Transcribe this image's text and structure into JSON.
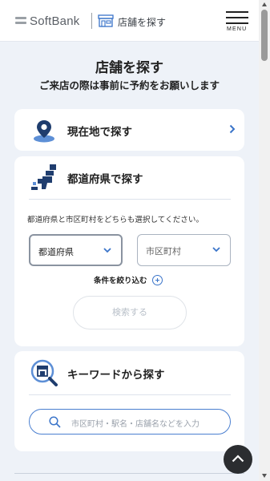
{
  "header": {
    "logo_text": "SoftBank",
    "title": "店舗を探す",
    "menu_label": "MENU"
  },
  "page": {
    "title": "店舗を探す",
    "subtitle": "ご来店の際は事前に予約をお願いします"
  },
  "location_card": {
    "label": "現在地で探す",
    "icon": "map-pin-icon"
  },
  "prefecture_card": {
    "label": "都道府県で探す",
    "icon": "japan-map-icon",
    "description": "都道府県と市区町村をどちらも選択してください。",
    "prefecture_select": "都道府県",
    "city_select": "市区町村",
    "filter_label": "条件を絞り込む",
    "search_button": "検索する"
  },
  "keyword_card": {
    "label": "キーワードから探す",
    "icon": "store-search-icon",
    "placeholder": "市区町村・駅名・店舗名などを入力"
  },
  "colors": {
    "accent": "#3a74c9",
    "background": "#eef2f8",
    "icon_dark": "#1f3d6e"
  }
}
